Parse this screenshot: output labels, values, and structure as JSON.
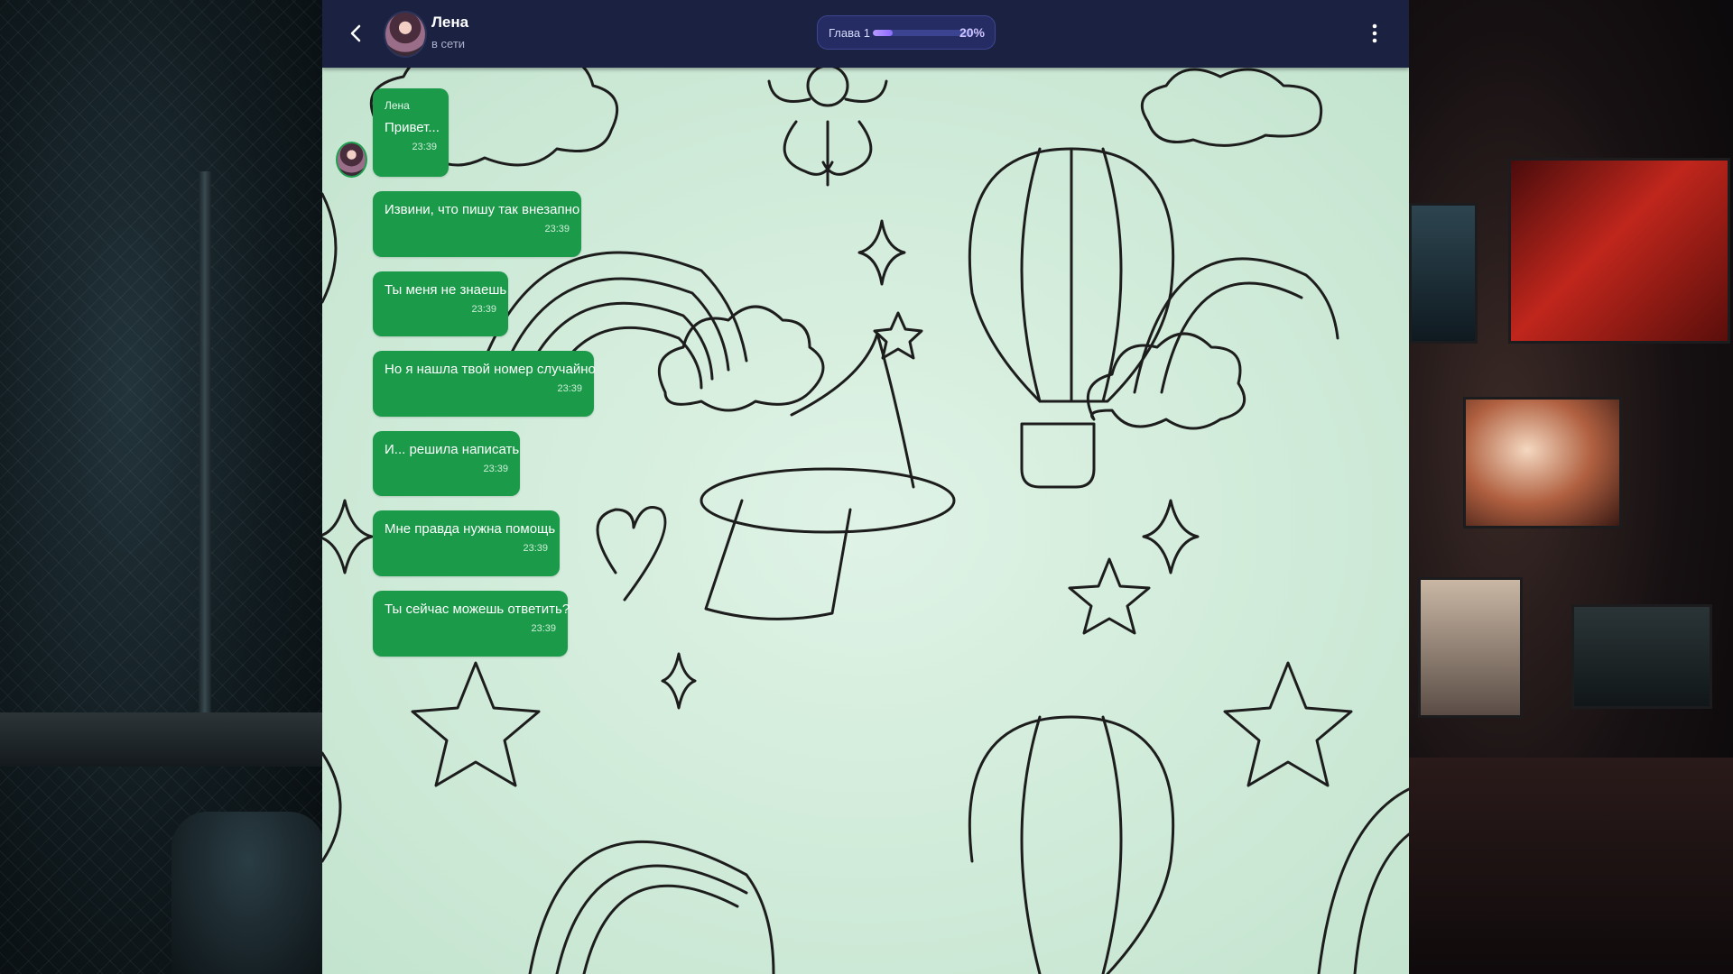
{
  "header": {
    "back_icon": "chevron-left-icon",
    "contact_name": "Лена",
    "contact_status": "в сети",
    "chapter_label": "Глава 1",
    "chapter_progress": 0.2,
    "chapter_percent": "20%",
    "menu_icon": "more-vertical-icon"
  },
  "messages": [
    {
      "sender": "Лена",
      "text": "Привет...",
      "time": "23:39"
    },
    {
      "text": "Извини, что пишу так внезапно",
      "time": "23:39"
    },
    {
      "text": "Ты меня не знаешь",
      "time": "23:39"
    },
    {
      "text": "Но я нашла твой номер случайно",
      "time": "23:39"
    },
    {
      "text": "И... решила написать",
      "time": "23:39"
    },
    {
      "text": "Мне правда нужна помощь",
      "time": "23:39"
    },
    {
      "text": "Ты сейчас можешь ответить?",
      "time": "23:39"
    }
  ],
  "colors": {
    "header_bg": "#1b2140",
    "bubble_bg": "#1b9a4a",
    "chat_bg": "#d4eddc",
    "progress_fill": "#9a7bff"
  }
}
